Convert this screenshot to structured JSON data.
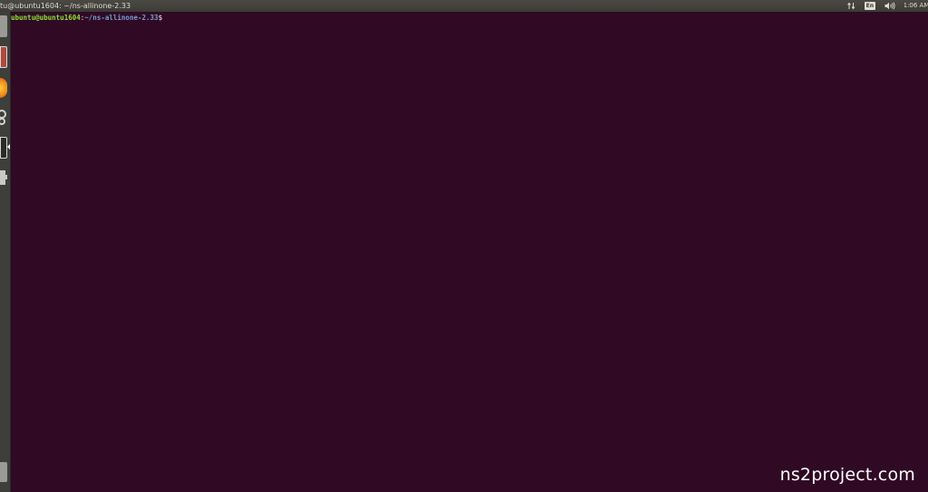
{
  "window": {
    "title": "tu@ubuntu1604: ~/ns-allinone-2.33"
  },
  "indicators": {
    "network_icon": "network-updown-icon",
    "keyboard_layout": "En",
    "volume_icon": "speaker-icon",
    "clock": "1:06 AM"
  },
  "launcher": {
    "items": [
      {
        "name": "files-icon",
        "color": "#9a9a96"
      },
      {
        "name": "app-red-icon",
        "color": "#b04a3e"
      },
      {
        "name": "firefox-icon",
        "color": "#f08c1a"
      },
      {
        "name": "settings-gear-icon",
        "color": "#c8c8c4"
      },
      {
        "name": "terminal-icon",
        "color": "#d8d8d4"
      },
      {
        "name": "app-plugin-icon",
        "color": "#c8c8c4"
      },
      {
        "name": "trash-icon",
        "color": "#9a9a96"
      }
    ]
  },
  "terminal": {
    "prompt_user": "ubuntu@ubuntu1604",
    "prompt_sep": ":",
    "prompt_path": "~/ns-allinone-2.33",
    "prompt_dollar": "$"
  },
  "watermark": {
    "text": "ns2project.com"
  },
  "colors": {
    "terminal_bg": "#300a24",
    "prompt_user": "#8ae234",
    "prompt_path": "#729fcf",
    "panel_bg": "#3c3b37"
  }
}
